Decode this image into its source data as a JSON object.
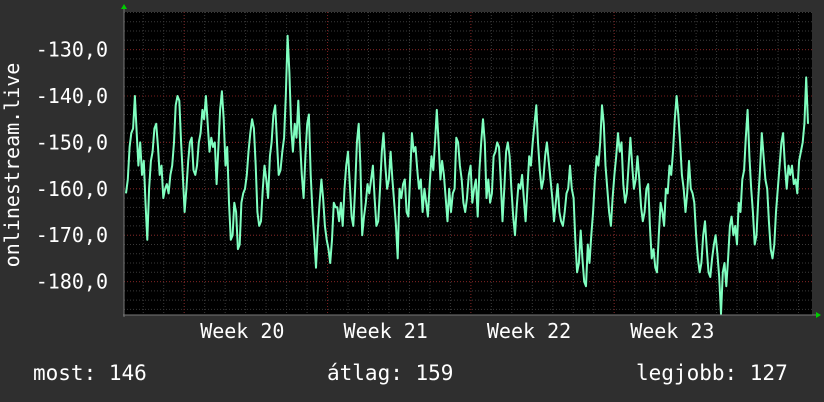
{
  "colors": {
    "background": "#2f2f2f",
    "plot_background": "#000000",
    "series": "#80ffc0",
    "grid": "#7a1e1e",
    "axis": "#777777",
    "arrow": "#00cc00",
    "text": "#ffffff"
  },
  "footer": {
    "now": "most: 146",
    "average": "átlag: 159",
    "best": "legjobb: 127"
  },
  "chart_data": {
    "type": "line",
    "title": "",
    "xlabel": "",
    "ylabel": "onlinestream.live",
    "y_tick_labels": [
      "-130,0",
      "-140,0",
      "-150,0",
      "-160,0",
      "-170,0",
      "-180,0"
    ],
    "y_ticks": [
      -130,
      -140,
      -150,
      -160,
      -170,
      -180
    ],
    "ylim": [
      -187.2,
      -121.9
    ],
    "x_tick_labels": [
      "Week 20",
      "Week 21",
      "Week 22",
      "Week 23"
    ],
    "x_ticks": [
      20,
      21,
      22,
      23
    ],
    "xlim": [
      19.58,
      24.38
    ],
    "grid": true,
    "series": [
      {
        "values": [
          -161,
          -158,
          -151,
          -148,
          -147,
          -140,
          -148,
          -155,
          -150,
          -157,
          -154,
          -163,
          -171,
          -160,
          -154,
          -152,
          -147,
          -146,
          -151,
          -157,
          -155,
          -162,
          -160,
          -159,
          -161,
          -157,
          -155,
          -150,
          -142,
          -140,
          -141,
          -150,
          -157,
          -165,
          -160,
          -154,
          -150,
          -149,
          -156,
          -157,
          -155,
          -150,
          -148,
          -143,
          -145,
          -140,
          -146,
          -152,
          -149,
          -151,
          -150,
          -159,
          -151,
          -143,
          -139,
          -145,
          -155,
          -151,
          -163,
          -171,
          -170,
          -163,
          -165,
          -173,
          -172,
          -163,
          -161,
          -160,
          -157,
          -152,
          -148,
          -145,
          -147,
          -155,
          -165,
          -168,
          -167,
          -160,
          -155,
          -158,
          -162,
          -153,
          -150,
          -144,
          -142,
          -150,
          -157,
          -156,
          -152,
          -149,
          -140,
          -127,
          -135,
          -147,
          -152,
          -146,
          -149,
          -141,
          -150,
          -157,
          -162,
          -153,
          -146,
          -144,
          -157,
          -165,
          -171,
          -177,
          -169,
          -163,
          -158,
          -162,
          -168,
          -171,
          -173,
          -176,
          -171,
          -163,
          -164,
          -164,
          -167,
          -163,
          -168,
          -160,
          -155,
          -152,
          -159,
          -166,
          -168,
          -160,
          -150,
          -146,
          -155,
          -170,
          -166,
          -163,
          -159,
          -161,
          -158,
          -155,
          -162,
          -168,
          -167,
          -160,
          -152,
          -148,
          -155,
          -160,
          -158,
          -152,
          -158,
          -163,
          -168,
          -175,
          -160,
          -162,
          -159,
          -158,
          -165,
          -166,
          -157,
          -148,
          -152,
          -151,
          -156,
          -160,
          -158,
          -165,
          -160,
          -163,
          -166,
          -159,
          -153,
          -156,
          -150,
          -143,
          -150,
          -158,
          -154,
          -157,
          -162,
          -167,
          -160,
          -165,
          -161,
          -160,
          -149,
          -150,
          -155,
          -158,
          -163,
          -165,
          -162,
          -157,
          -155,
          -163,
          -160,
          -158,
          -166,
          -156,
          -150,
          -145,
          -150,
          -162,
          -158,
          -163,
          -161,
          -153,
          -152,
          -150,
          -151,
          -158,
          -167,
          -160,
          -152,
          -150,
          -153,
          -160,
          -166,
          -170,
          -164,
          -159,
          -160,
          -157,
          -162,
          -167,
          -160,
          -153,
          -155,
          -150,
          -146,
          -142,
          -150,
          -156,
          -160,
          -158,
          -153,
          -150,
          -154,
          -158,
          -162,
          -167,
          -163,
          -159,
          -165,
          -167,
          -168,
          -165,
          -161,
          -160,
          -155,
          -160,
          -162,
          -171,
          -178,
          -176,
          -169,
          -175,
          -180,
          -181,
          -172,
          -176,
          -170,
          -165,
          -158,
          -153,
          -155,
          -150,
          -142,
          -146,
          -155,
          -160,
          -165,
          -168,
          -162,
          -157,
          -153,
          -148,
          -152,
          -150,
          -159,
          -163,
          -161,
          -155,
          -149,
          -155,
          -160,
          -158,
          -153,
          -158,
          -164,
          -167,
          -165,
          -160,
          -159,
          -168,
          -175,
          -173,
          -177,
          -178,
          -170,
          -163,
          -165,
          -168,
          -160,
          -161,
          -155,
          -157,
          -152,
          -145,
          -140,
          -144,
          -150,
          -157,
          -160,
          -165,
          -161,
          -154,
          -160,
          -161,
          -163,
          -170,
          -175,
          -178,
          -176,
          -170,
          -167,
          -173,
          -178,
          -179,
          -175,
          -172,
          -170,
          -174,
          -179,
          -187,
          -178,
          -176,
          -181,
          -175,
          -168,
          -166,
          -170,
          -168,
          -172,
          -163,
          -165,
          -158,
          -156,
          -149,
          -143,
          -153,
          -160,
          -165,
          -172,
          -170,
          -162,
          -156,
          -148,
          -153,
          -158,
          -160,
          -167,
          -173,
          -175,
          -172,
          -165,
          -160,
          -155,
          -150,
          -148,
          -155,
          -160,
          -155,
          -157,
          -155,
          -159,
          -158,
          -161,
          -154,
          -152,
          -150,
          -146,
          -136,
          -146
        ]
      }
    ]
  }
}
